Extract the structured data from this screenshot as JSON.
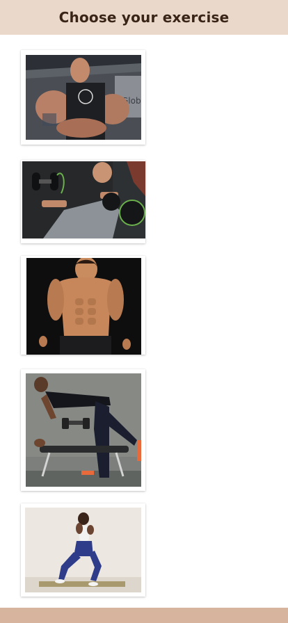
{
  "header": {
    "title": "Choose your exercise"
  },
  "exercises": [
    {
      "icon": "bodybuilder-flexing-photo"
    },
    {
      "icon": "dumbbell-incline-press-photo"
    },
    {
      "icon": "shirtless-abs-photo"
    },
    {
      "icon": "dumbbell-row-bench-photo"
    },
    {
      "icon": "lunge-woman-photo"
    }
  ],
  "colors": {
    "header_bg": "#ead9cb",
    "header_text": "#3a2418",
    "footer_bg": "#d6b49e"
  }
}
